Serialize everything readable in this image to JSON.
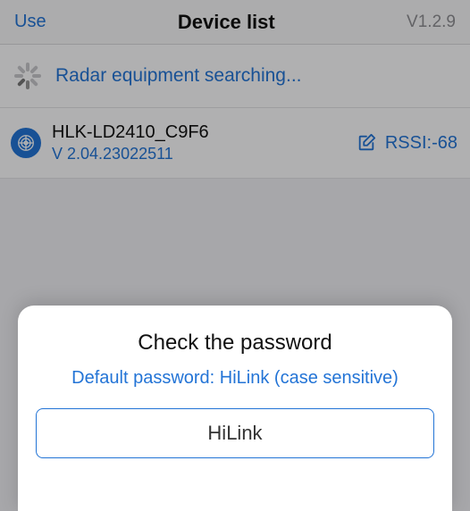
{
  "header": {
    "use_label": "Use",
    "title": "Device list",
    "version": "V1.2.9"
  },
  "search": {
    "text": "Radar equipment searching..."
  },
  "device": {
    "name": "HLK-LD2410_C9F6",
    "version": "V 2.04.23022511",
    "rssi_label": "RSSI:-68"
  },
  "dialog": {
    "title": "Check the password",
    "subtitle": "Default password: HiLink (case sensitive)",
    "input_value": "HiLink"
  },
  "icons": {
    "spinner": "spinner-icon",
    "radar": "radar-icon",
    "edit": "edit-icon"
  }
}
